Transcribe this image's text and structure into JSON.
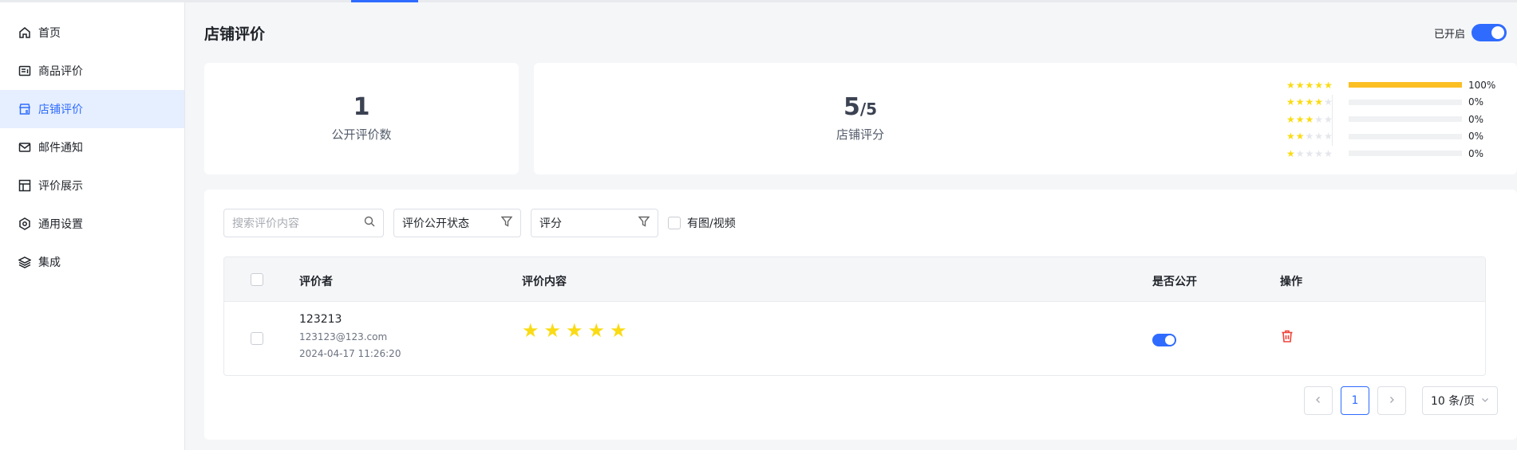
{
  "sidebar": {
    "items": [
      {
        "label": "首页",
        "icon": "home-icon",
        "active": false
      },
      {
        "label": "商品评价",
        "icon": "product-review-icon",
        "active": false
      },
      {
        "label": "店铺评价",
        "icon": "store-icon",
        "active": true
      },
      {
        "label": "邮件通知",
        "icon": "mail-icon",
        "active": false
      },
      {
        "label": "评价展示",
        "icon": "layout-icon",
        "active": false
      },
      {
        "label": "通用设置",
        "icon": "settings-icon",
        "active": false
      },
      {
        "label": "集成",
        "icon": "layers-icon",
        "active": false
      }
    ]
  },
  "header": {
    "title": "店铺评价",
    "toggle_label": "已开启",
    "toggle_on": true
  },
  "stats": {
    "public_count": "1",
    "public_count_label": "公开评价数",
    "score": "5",
    "score_denom": "/5",
    "score_label": "店铺评分",
    "distribution": [
      {
        "stars": 5,
        "percent": 100,
        "label": "100%"
      },
      {
        "stars": 4,
        "percent": 0,
        "label": "0%"
      },
      {
        "stars": 3,
        "percent": 0,
        "label": "0%"
      },
      {
        "stars": 2,
        "percent": 0,
        "label": "0%"
      },
      {
        "stars": 1,
        "percent": 0,
        "label": "0%"
      }
    ]
  },
  "filters": {
    "search_placeholder": "搜索评价内容",
    "status_filter": "评价公开状态",
    "rating_filter": "评分",
    "media_checkbox": "有图/视频"
  },
  "table": {
    "headers": {
      "reviewer": "评价者",
      "content": "评价内容",
      "public": "是否公开",
      "actions": "操作"
    },
    "rows": [
      {
        "name": "123213",
        "email": "123123@123.com",
        "date": "2024-04-17 11:26:20",
        "rating": 5,
        "public": true
      }
    ]
  },
  "pagination": {
    "prev": "<",
    "current": "1",
    "next": ">",
    "page_size": "10 条/页"
  },
  "colors": {
    "accent": "#2f6bff",
    "star": "#fadb14",
    "bar": "#fbbf24",
    "danger": "#f04438"
  }
}
